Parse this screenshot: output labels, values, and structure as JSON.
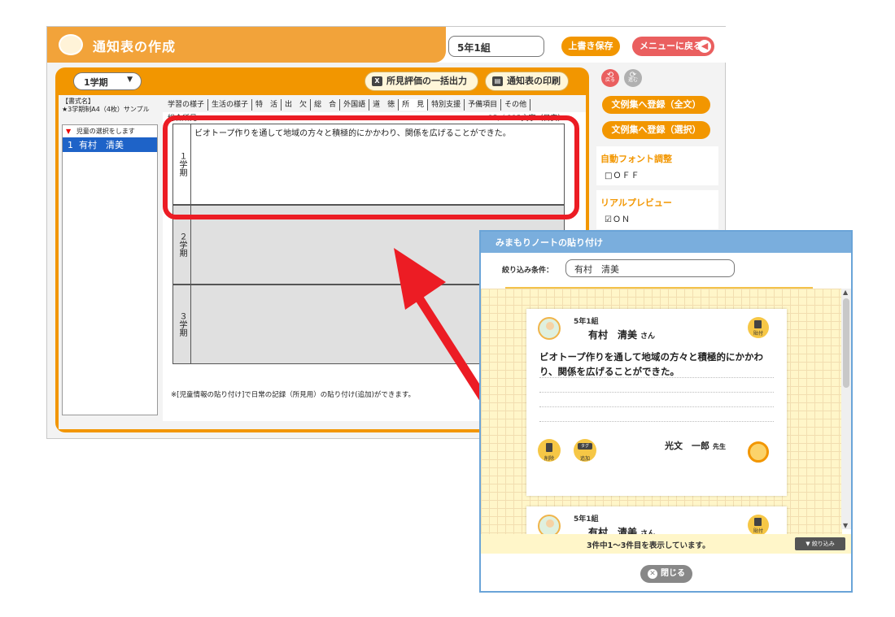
{
  "app": {
    "title": "通知表の作成",
    "class_name": "5年1組",
    "save_label": "上書き保存",
    "menu_label": "メニューに戻る",
    "term_selected": "1学期",
    "bulk_output_label": "所見評価の一括出力",
    "print_label": "通知表の印刷"
  },
  "format": {
    "label": "【書式名】",
    "name": "★3学期制A4（4枚）サンプル"
  },
  "student_list": {
    "header": "児童の選択をします",
    "rows": [
      {
        "no": "1",
        "name": "有村　清美"
      }
    ]
  },
  "tabs": [
    "学習の様子",
    "生活の様子",
    "特　活",
    "出　欠",
    "総　合",
    "外国語",
    "道　徳",
    "所　見",
    "特別支援",
    "予備項目",
    "その他"
  ],
  "active_tab": "所　見",
  "content": {
    "section_title": "総合所見",
    "counter": "35／ 235文字（目安）",
    "terms": [
      {
        "label": "１学期",
        "text": "ビオトープ作りを通して地域の方々と積極的にかかわり、関係を広げることができた。"
      },
      {
        "label": "２学期",
        "text": ""
      },
      {
        "label": "３学期",
        "text": ""
      }
    ],
    "footnote": "※[児童情報の貼り付け]で日常の記録（所見用）の貼り付け(追加)ができます。"
  },
  "sidebar": {
    "back_label": "戻る",
    "forward_label": "進む",
    "register_all_label": "文例集へ登録（全文）",
    "register_select_label": "文例集へ登録（選択）",
    "auto_font_title": "自動フォント調整",
    "auto_font_value": "□ＯＦＦ",
    "preview_title": "リアルプレビュー",
    "preview_value": "☑ＯＮ"
  },
  "dialog": {
    "title": "みまもりノートの貼り付け",
    "filter_label": "絞り込み条件：",
    "filter_value": "有村　清美",
    "cards": [
      {
        "class_name": "5年1組",
        "student_name": "有村　清美",
        "honorific": "さん",
        "paste_label": "貼付",
        "text": "ビオトープ作りを通して地域の方々と積極的にかかわり、関係を広げることができた。",
        "delete_label": "削除",
        "tag_add_label": "追加",
        "teacher_name": "光文　一郎",
        "teacher_honorific": "先生"
      },
      {
        "class_name": "5年1組",
        "student_name": "有村　清美",
        "honorific": "さん",
        "paste_label": "貼付"
      }
    ],
    "status": "3件中1～3件目を表示しています。",
    "narrow_label": "絞り込み",
    "close_label": "閉じる"
  },
  "colors": {
    "accent_orange": "#f29600",
    "title_orange": "#f2a33a",
    "menu_red": "#ea5f5f",
    "highlight_red": "#ec1c24",
    "dialog_blue": "#7aaedd",
    "selection_blue": "#1e63c8"
  }
}
